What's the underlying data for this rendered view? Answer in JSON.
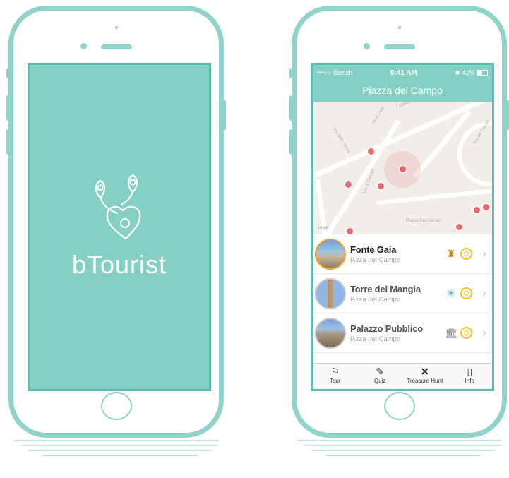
{
  "splash": {
    "brand": "bTourist"
  },
  "app": {
    "status": {
      "carrier": "•••○○ Sketch",
      "time": "9:41 AM",
      "battery": "42%"
    },
    "nav_title": "Piazza del Campo",
    "map_labels": {
      "piazza": "Piazza Del Campo",
      "legal": "Legal",
      "via_citta": "Via di Città",
      "via_terme": "Via delle Terme",
      "via_campo": "Via di Campo",
      "v_casato": "Via del Casato",
      "costarella": "Costarella"
    },
    "places": [
      {
        "name": "Fonte Gaia",
        "address": "P.zza del Campo",
        "category_icon": "statue-icon",
        "glyph": "♜"
      },
      {
        "name": "Torre del Mangia",
        "address": "P.zza del Campo",
        "category_icon": "fountain-icon",
        "glyph": "✳"
      },
      {
        "name": "Palazzo Pubblico",
        "address": "P.zza del Campo",
        "category_icon": "building-icon",
        "glyph": "🏛"
      }
    ],
    "tabs": [
      {
        "label": "Tour",
        "icon": "flag-icon",
        "glyph": "⚐"
      },
      {
        "label": "Quiz",
        "icon": "pencil-icon",
        "glyph": "✎"
      },
      {
        "label": "Treasure Hunt",
        "icon": "cross-icon",
        "glyph": "✕"
      },
      {
        "label": "Info",
        "icon": "book-icon",
        "glyph": "▯"
      }
    ]
  },
  "colors": {
    "teal": "#84d0c4",
    "teal_dark": "#5bbcb0",
    "frame": "#8fd3cb",
    "pin": "#e46a6f",
    "coin": "#f4c41c",
    "active_ring": "#f0a21a"
  }
}
